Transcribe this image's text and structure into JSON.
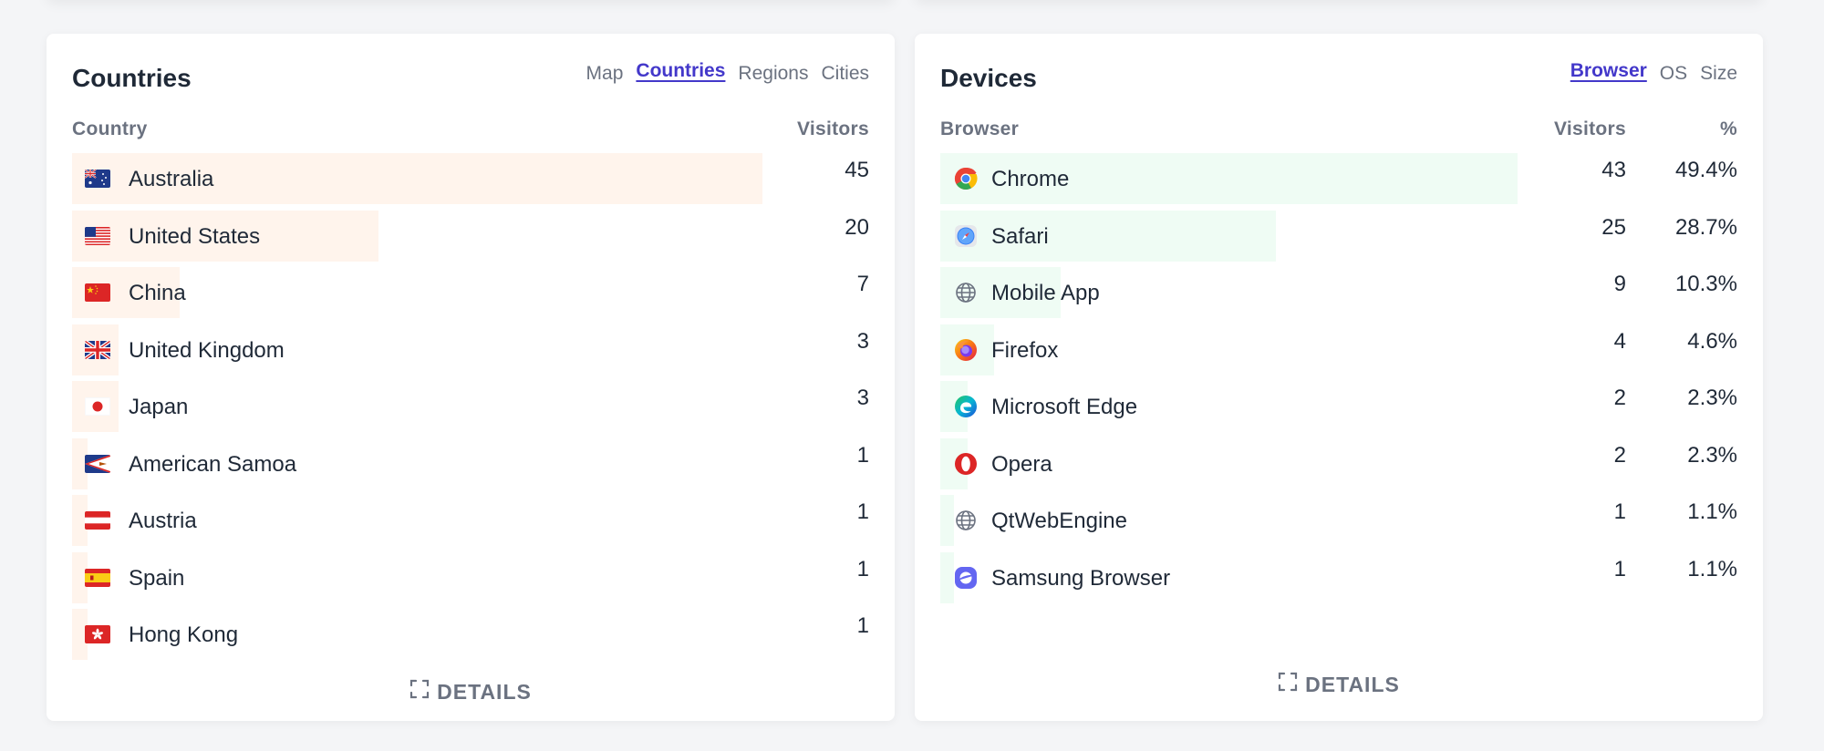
{
  "countries_card": {
    "title": "Countries",
    "tabs": [
      {
        "label": "Map",
        "active": false
      },
      {
        "label": "Countries",
        "active": true
      },
      {
        "label": "Regions",
        "active": false
      },
      {
        "label": "Cities",
        "active": false
      }
    ],
    "col_name": "Country",
    "col_visitors": "Visitors",
    "rows": [
      {
        "name": "Australia",
        "visitors": "45",
        "share": 1.0,
        "flag": "au-flag-icon"
      },
      {
        "name": "United States",
        "visitors": "20",
        "share": 0.444,
        "flag": "us-flag-icon"
      },
      {
        "name": "China",
        "visitors": "7",
        "share": 0.156,
        "flag": "cn-flag-icon"
      },
      {
        "name": "United Kingdom",
        "visitors": "3",
        "share": 0.067,
        "flag": "gb-flag-icon"
      },
      {
        "name": "Japan",
        "visitors": "3",
        "share": 0.067,
        "flag": "jp-flag-icon"
      },
      {
        "name": "American Samoa",
        "visitors": "1",
        "share": 0.022,
        "flag": "as-flag-icon"
      },
      {
        "name": "Austria",
        "visitors": "1",
        "share": 0.022,
        "flag": "at-flag-icon"
      },
      {
        "name": "Spain",
        "visitors": "1",
        "share": 0.022,
        "flag": "es-flag-icon"
      },
      {
        "name": "Hong Kong",
        "visitors": "1",
        "share": 0.022,
        "flag": "hk-flag-icon"
      }
    ],
    "details_label": "DETAILS"
  },
  "devices_card": {
    "title": "Devices",
    "tabs": [
      {
        "label": "Browser",
        "active": true
      },
      {
        "label": "OS",
        "active": false
      },
      {
        "label": "Size",
        "active": false
      }
    ],
    "col_name": "Browser",
    "col_visitors": "Visitors",
    "col_percent": "%",
    "rows": [
      {
        "name": "Chrome",
        "visitors": "43",
        "percent": "49.4%",
        "share": 1.0,
        "icon": "chrome-icon"
      },
      {
        "name": "Safari",
        "visitors": "25",
        "percent": "28.7%",
        "share": 0.581,
        "icon": "safari-icon"
      },
      {
        "name": "Mobile App",
        "visitors": "9",
        "percent": "10.3%",
        "share": 0.209,
        "icon": "globe-icon"
      },
      {
        "name": "Firefox",
        "visitors": "4",
        "percent": "4.6%",
        "share": 0.093,
        "icon": "firefox-icon"
      },
      {
        "name": "Microsoft Edge",
        "visitors": "2",
        "percent": "2.3%",
        "share": 0.047,
        "icon": "edge-icon"
      },
      {
        "name": "Opera",
        "visitors": "2",
        "percent": "2.3%",
        "share": 0.047,
        "icon": "opera-icon"
      },
      {
        "name": "QtWebEngine",
        "visitors": "1",
        "percent": "1.1%",
        "share": 0.023,
        "icon": "globe-icon"
      },
      {
        "name": "Samsung Browser",
        "visitors": "1",
        "percent": "1.1%",
        "share": 0.023,
        "icon": "samsung-browser-icon"
      }
    ],
    "details_label": "DETAILS"
  },
  "colors": {
    "accent": "#4338ca",
    "country_bar": "#fff4ec",
    "browser_bar": "#effcf4",
    "muted_text": "#6b7280"
  }
}
